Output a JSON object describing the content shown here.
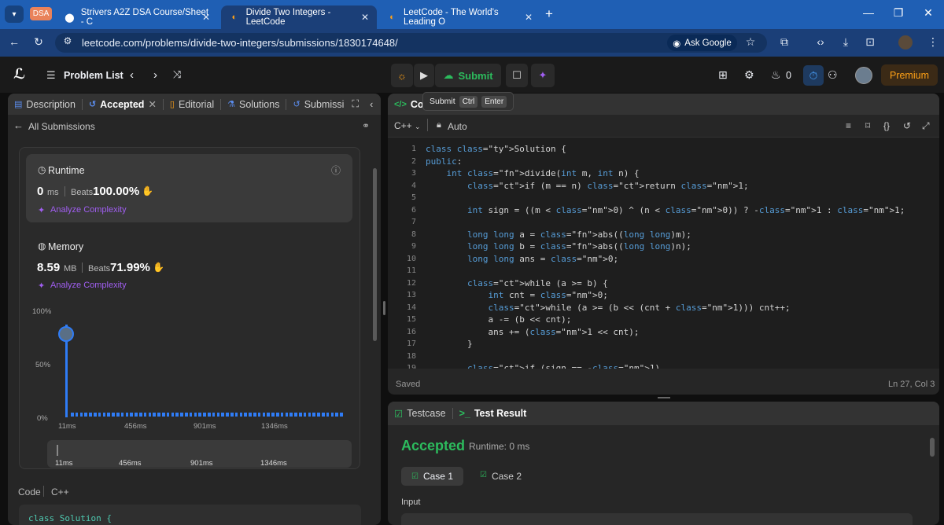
{
  "browser": {
    "dsa_chip": "DSA",
    "tabs": [
      {
        "title": "Strivers A2Z DSA Course/Sheet - C"
      },
      {
        "title": "Divide Two Integers - LeetCode"
      },
      {
        "title": "LeetCode - The World's Leading O"
      }
    ],
    "url": "leetcode.com/problems/divide-two-integers/submissions/1830174648/",
    "ask_google": "Ask Google"
  },
  "nav": {
    "problem_list": "Problem List",
    "submit": "Submit",
    "streak_count": "0",
    "premium": "Premium"
  },
  "tooltip": {
    "label": "Submit",
    "key1": "Ctrl",
    "key2": "Enter"
  },
  "left_tabs": [
    {
      "label": "Description"
    },
    {
      "label": "Accepted"
    },
    {
      "label": "Editorial"
    },
    {
      "label": "Solutions"
    },
    {
      "label": "Submissi"
    }
  ],
  "submission": {
    "back_label": "All Submissions",
    "runtime": {
      "title": "Runtime",
      "value": "0",
      "unit": "ms",
      "beats_label": "Beats",
      "beats": "100.00%"
    },
    "memory": {
      "title": "Memory",
      "value": "8.59",
      "unit": "MB",
      "beats_label": "Beats",
      "beats": "71.99%"
    },
    "analyze": "Analyze Complexity",
    "chart_data": {
      "type": "bar",
      "y_ticks": [
        "100%",
        "50%",
        "0%"
      ],
      "x_ticks": [
        "11ms",
        "456ms",
        "901ms",
        "1346ms"
      ],
      "highlight": {
        "x": "0ms",
        "y": 100
      },
      "note": "Distribution of runtimes; single bar at ~0ms reaching 100%, remaining bars near 0%"
    },
    "scrub_ticks": [
      "11ms",
      "456ms",
      "901ms",
      "1346ms"
    ],
    "code_header": {
      "label": "Code",
      "lang": "C++"
    },
    "code_preview": "class Solution {"
  },
  "editor": {
    "tab_label": "Co",
    "language": "C++",
    "auto": "Auto",
    "status": "Saved",
    "cursor": "Ln 27, Col 3",
    "lines": [
      "class Solution {",
      "public:",
      "    int divide(int m, int n) {",
      "        if (m == n) return 1;",
      "",
      "        int sign = ((m < 0) ^ (n < 0)) ? -1 : 1;",
      "",
      "        long long a = abs((long long)m);",
      "        long long b = abs((long long)n);",
      "        long long ans = 0;",
      "",
      "        while (a >= b) {",
      "            int cnt = 0;",
      "            while (a >= (b << (cnt + 1))) cnt++;",
      "            a -= (b << cnt);",
      "            ans += (1 << cnt);",
      "        }",
      "",
      "        if (sign == -1) ..."
    ]
  },
  "result": {
    "tab_testcase": "Testcase",
    "tab_result": "Test Result",
    "status": "Accepted",
    "runtime": "Runtime: 0 ms",
    "case1": "Case 1",
    "case2": "Case 2",
    "input_label": "Input"
  }
}
